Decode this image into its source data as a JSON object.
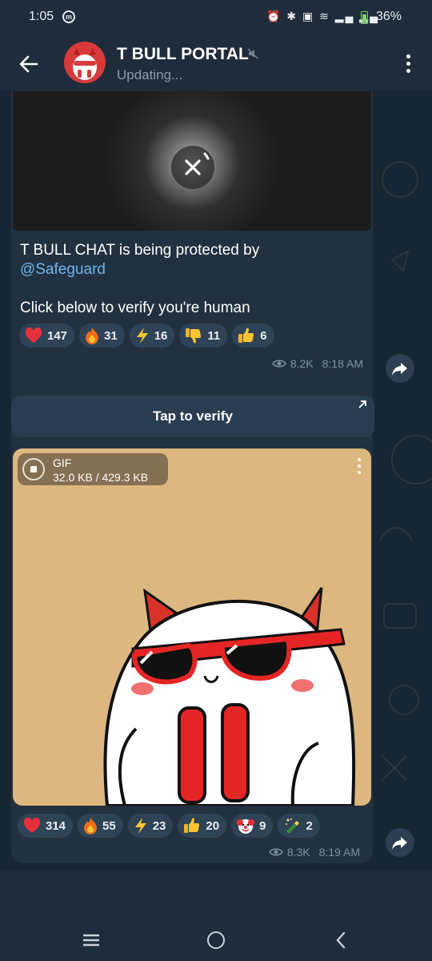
{
  "status_bar": {
    "time": "1:05",
    "battery": "36%",
    "icons": "⏰ ✱ ▣ ≋ ▂▄ ▂▄"
  },
  "header": {
    "title": "T BULL PORTAL",
    "status": "Updating...",
    "icons": {
      "back": "arrow-left-icon",
      "mute": "mute-icon",
      "menu": "more-vertical-icon"
    }
  },
  "messages": [
    {
      "text_line1": "T BULL CHAT is being protected by",
      "mention": "@Safeguard",
      "text_line2": "Click below to verify you're human",
      "reactions": [
        {
          "emoji": "heart",
          "count": "147"
        },
        {
          "emoji": "fire",
          "count": "31"
        },
        {
          "emoji": "lightning",
          "count": "16"
        },
        {
          "emoji": "thumbs-down",
          "count": "11"
        },
        {
          "emoji": "thumbs-up",
          "count": "6"
        }
      ],
      "views": "8.2K",
      "time": "8:18 AM"
    },
    {
      "gif_label": "GIF",
      "gif_size": "32.0 KB / 429.3 KB",
      "reactions": [
        {
          "emoji": "heart",
          "count": "314"
        },
        {
          "emoji": "fire",
          "count": "55"
        },
        {
          "emoji": "lightning",
          "count": "23"
        },
        {
          "emoji": "thumbs-up",
          "count": "20"
        },
        {
          "emoji": "clown",
          "count": "9"
        },
        {
          "emoji": "champagne",
          "count": "2"
        }
      ],
      "views": "8.3K",
      "time": "8:19 AM"
    }
  ],
  "verify_button": {
    "label": "Tap to verify"
  },
  "colors": {
    "accent": "#6cb6ef",
    "bubble": "#223140",
    "background": "#172633",
    "gif_bg": "#dcb77f"
  }
}
